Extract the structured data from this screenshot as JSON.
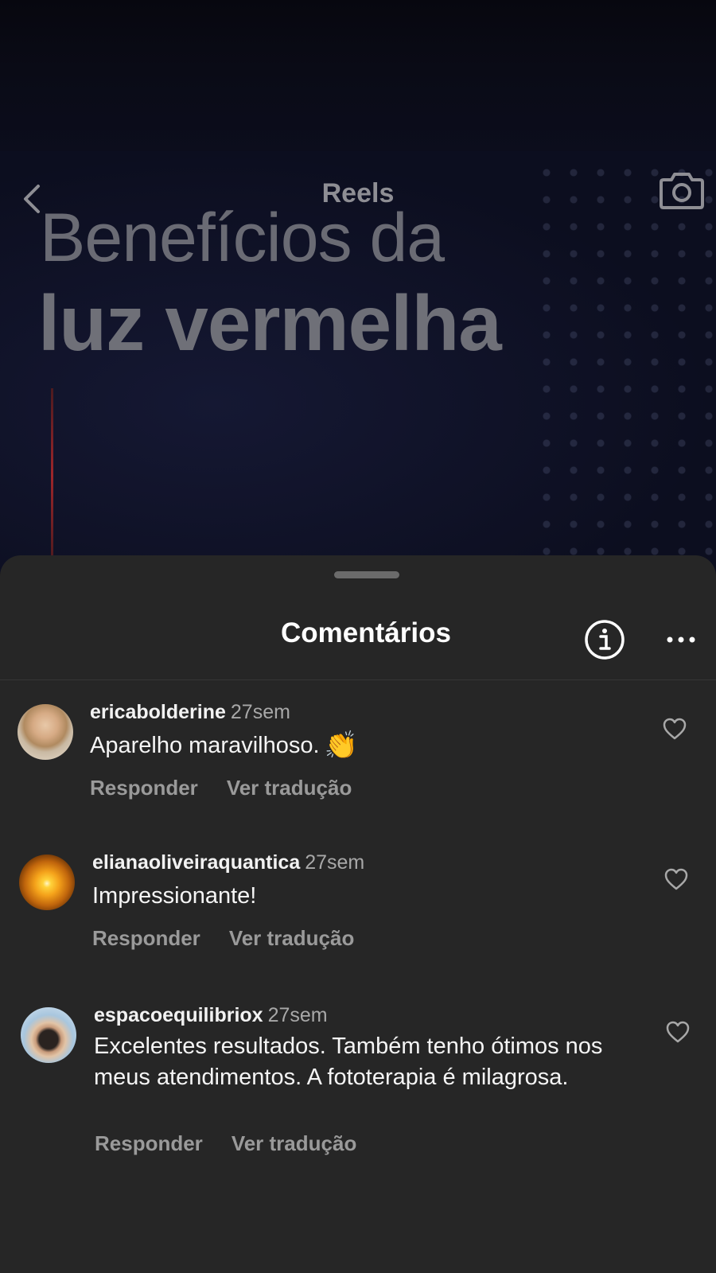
{
  "header": {
    "title": "Reels",
    "back_icon": "chevron-left-icon",
    "camera_icon": "camera-icon"
  },
  "video": {
    "title_line1": "Benefícios da",
    "title_line2": "luz vermelha"
  },
  "comments_sheet": {
    "title": "Comentários",
    "info_icon": "info-icon",
    "more_icon": "more-horizontal-icon",
    "comments": [
      {
        "username": "ericabolderine",
        "time": "27sem",
        "text": "Aparelho maravilhoso.",
        "emoji": "👏",
        "reply_label": "Responder",
        "translate_label": "Ver tradução"
      },
      {
        "username": "elianaoliveiraquantica",
        "time": "27sem",
        "text": "Impressionante!",
        "reply_label": "Responder",
        "translate_label": "Ver tradução"
      },
      {
        "username": "espacoequilibriox",
        "time": "27sem",
        "text": "Excelentes resultados. Também tenho ótimos nos meus atendimentos. A fototerapia é milagrosa.",
        "reply_label": "Responder",
        "translate_label": "Ver tradução"
      }
    ]
  },
  "colors": {
    "sheet_bg": "#262626",
    "text_primary": "#ffffff",
    "text_secondary": "#a8a8a8"
  }
}
